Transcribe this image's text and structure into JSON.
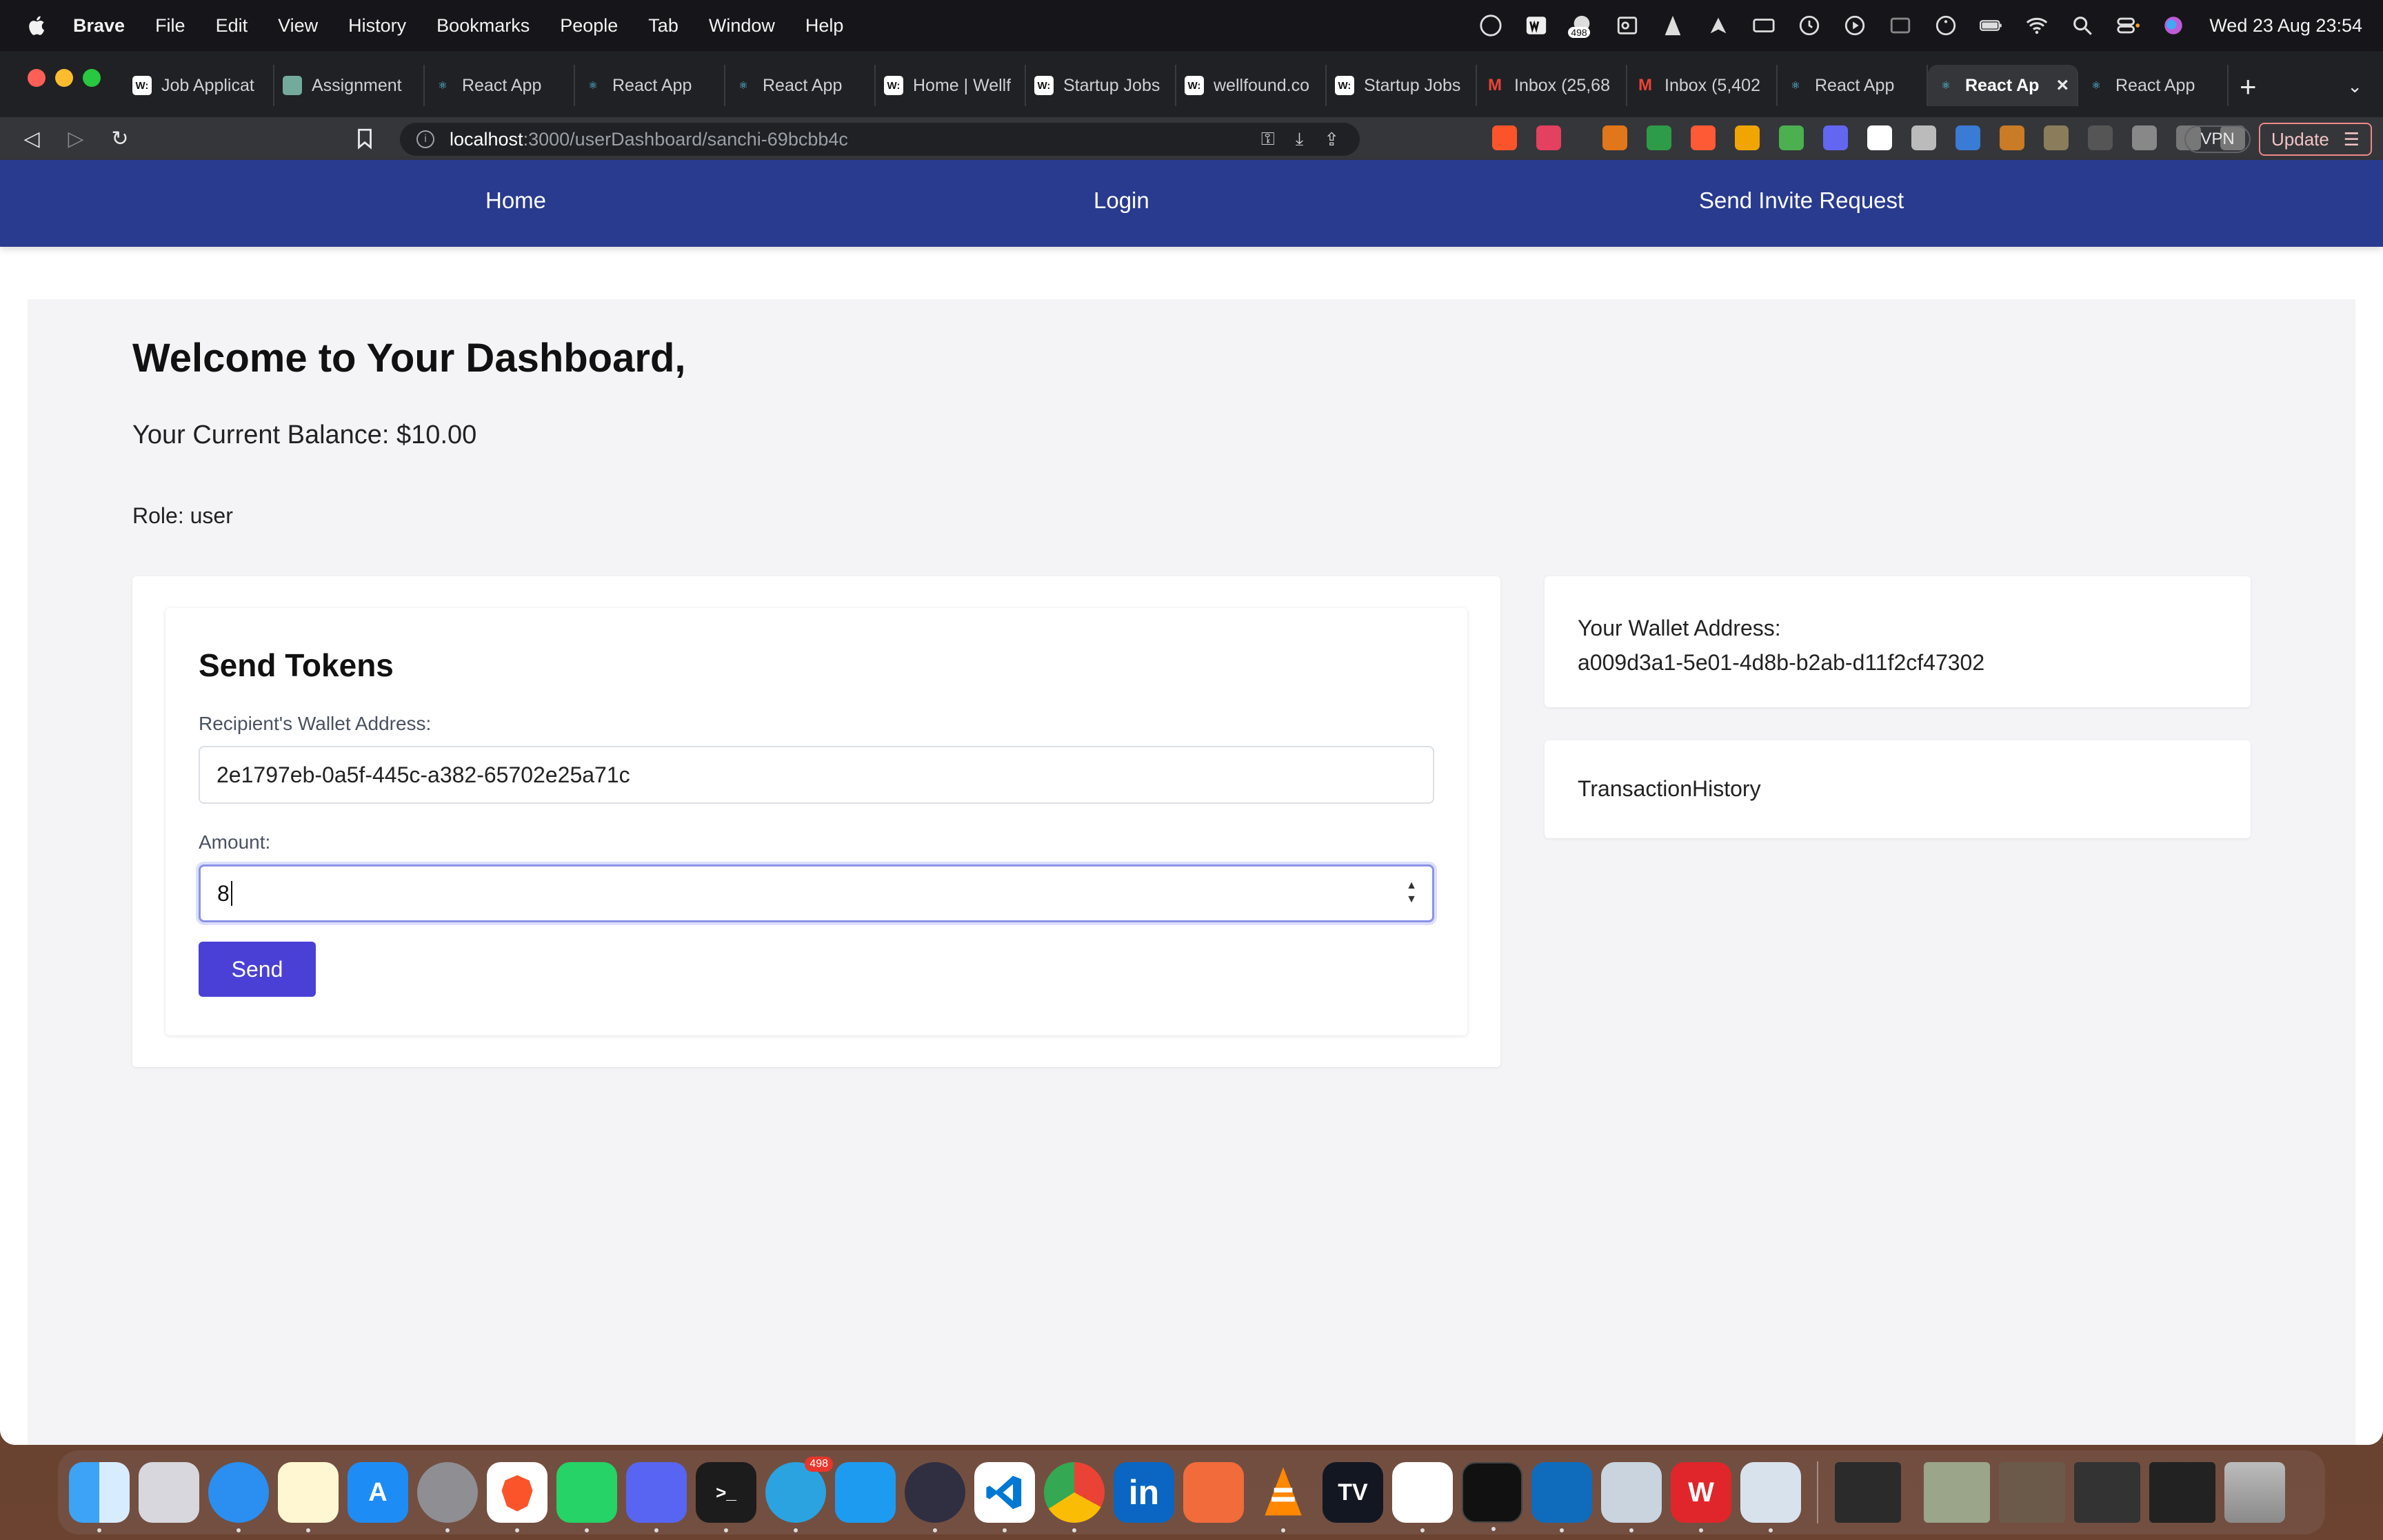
{
  "menubar": {
    "app_name": "Brave",
    "menus": [
      "File",
      "Edit",
      "View",
      "History",
      "Bookmarks",
      "People",
      "Tab",
      "Window",
      "Help"
    ],
    "badge_count": "498",
    "clock": "Wed 23 Aug  23:54"
  },
  "browser": {
    "tabs": [
      {
        "title": "Job Applicat",
        "icon": "wellfound-icon"
      },
      {
        "title": "Assignment",
        "icon": "chatgpt-icon"
      },
      {
        "title": "React App",
        "icon": "react-icon"
      },
      {
        "title": "React App",
        "icon": "react-icon"
      },
      {
        "title": "React App",
        "icon": "react-icon"
      },
      {
        "title": "Home | Wellf",
        "icon": "wellfound-icon"
      },
      {
        "title": "Startup Jobs",
        "icon": "wellfound-icon"
      },
      {
        "title": "wellfound.co",
        "icon": "wellfound-icon"
      },
      {
        "title": "Startup Jobs",
        "icon": "wellfound-icon"
      },
      {
        "title": "Inbox (25,68",
        "icon": "gmail-icon"
      },
      {
        "title": "Inbox (5,402",
        "icon": "gmail-icon"
      },
      {
        "title": "React App",
        "icon": "react-icon"
      },
      {
        "title": "React Ap",
        "icon": "react-icon",
        "active": true
      },
      {
        "title": "React App",
        "icon": "react-icon"
      }
    ],
    "url_host": "localhost",
    "url_path": ":3000/userDashboard/sanchi-69bcbb4c",
    "vpn_label": "VPN",
    "update_label": "Update"
  },
  "nav": {
    "home": "Home",
    "login": "Login",
    "invite": "Send Invite Request"
  },
  "dashboard": {
    "welcome": "Welcome to Your Dashboard,",
    "balance": "Your Current Balance: $10.00",
    "role": "Role: user"
  },
  "send_tokens": {
    "title": "Send Tokens",
    "recipient_label": "Recipient's Wallet Address:",
    "recipient_value": "2e1797eb-0a5f-445c-a382-65702e25a71c",
    "amount_label": "Amount:",
    "amount_value": "8",
    "send_label": "Send"
  },
  "wallet": {
    "label": "Your Wallet Address:",
    "address": "a009d3a1-5e01-4d8b-b2ab-d11f2cf47302"
  },
  "transaction_history": {
    "label": "TransactionHistory"
  },
  "dock": {
    "telegram_badge": "498",
    "apps": [
      "finder",
      "launchpad",
      "safari",
      "notes",
      "app-store",
      "system-settings",
      "brave",
      "whatsapp",
      "discord",
      "terminal",
      "telegram",
      "twitter",
      "obs",
      "vscode",
      "chrome",
      "linkedin",
      "pen",
      "vlc",
      "tradingview",
      "slack",
      "activity-monitor",
      "outlook",
      "preview",
      "wps",
      "pgadmin"
    ]
  },
  "colors": {
    "nav_bg": "#293b8f",
    "send_button": "#4a40d6",
    "focus_ring": "#8b93e8"
  }
}
